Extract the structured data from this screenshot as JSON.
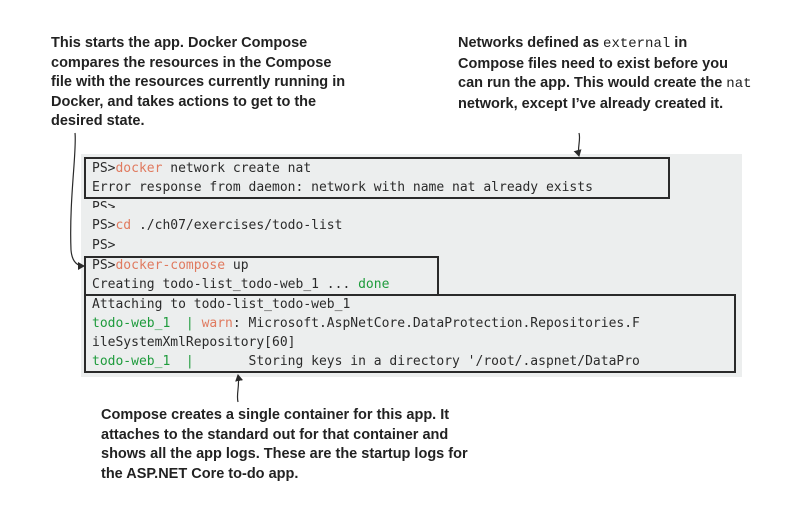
{
  "callouts": {
    "left": "This starts the app. Docker Compose compares the resources in the Compose file with the resources currently running in Docker, and takes actions to get to the desired state.",
    "right_part1": "Networks defined as ",
    "right_code1": "external",
    "right_part2": " in Compose files need to exist before you can run the app. This would create the ",
    "right_code2": "nat",
    "right_part3": " network, except I’ve already created it.",
    "bottom": "Compose creates a single container for this app. It attaches to the standard out for that container and shows all the app logs. These are the startup logs for the ASP.NET Core to-do app."
  },
  "terminal": {
    "prompt": "PS>",
    "line1_cmd": "docker",
    "line1_rest": " network create nat",
    "line2": "Error response from daemon: network with name nat already exists",
    "line3": "PS>",
    "line4_cmd": "cd",
    "line4_rest": " ./ch07/exercises/todo-list",
    "line5": "PS>",
    "line6_cmd": "docker-compose",
    "line6_rest": " up",
    "line7_text": "Creating todo-list_todo-web_1 ... ",
    "line7_status": "done",
    "line8": "Attaching to todo-list_todo-web_1",
    "line9_container": "todo-web_1  | ",
    "line9_level": "warn",
    "line9_rest": ": Microsoft.AspNetCore.DataProtection.Repositories.F",
    "line10": "ileSystemXmlRepository[60]",
    "line11_container": "todo-web_1  | ",
    "line11_rest": "      Storing keys in a directory '/root/.aspnet/DataPro"
  },
  "colors": {
    "command": "#e07a5f",
    "container": "#1e9b3c",
    "terminal_bg": "#eceeee"
  }
}
